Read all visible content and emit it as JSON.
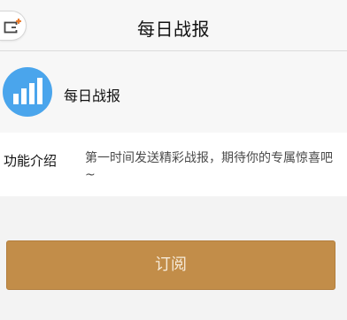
{
  "header": {
    "title": "每日战报",
    "back_icon": "exit-icon",
    "accent_color": "#e8792b"
  },
  "account": {
    "name": "每日战报",
    "avatar_icon": "bar-chart-icon",
    "avatar_color": "#4aa5ec"
  },
  "intro": {
    "label": "功能介绍",
    "text": "第一时间发送精彩战报，期待你的专属惊喜吧~"
  },
  "subscribe": {
    "label": "订阅",
    "color": "#c28d49"
  }
}
